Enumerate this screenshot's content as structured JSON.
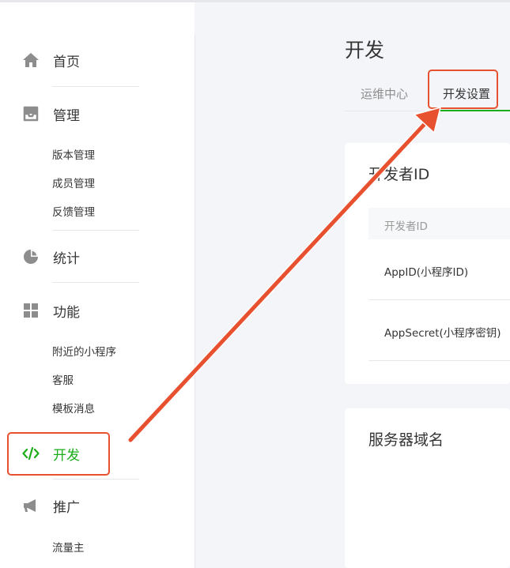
{
  "sidebar": {
    "home": "首页",
    "manage": "管理",
    "manage_items": [
      "版本管理",
      "成员管理",
      "反馈管理"
    ],
    "stats": "统计",
    "features": "功能",
    "feature_items": [
      "附近的小程序",
      "客服",
      "模板消息"
    ],
    "develop": "开发",
    "promote": "推广",
    "promote_items": [
      "流量主"
    ]
  },
  "main": {
    "title": "开发",
    "tabs": [
      {
        "label": "运维中心",
        "active": false
      },
      {
        "label": "开发设置",
        "active": true
      }
    ],
    "dev_id_card": {
      "title": "开发者ID",
      "header": "开发者ID",
      "rows": [
        "AppID(小程序ID)",
        "AppSecret(小程序密钥)"
      ]
    },
    "server_card": {
      "title": "服务器域名"
    }
  },
  "colors": {
    "accent": "#1aad19",
    "annotation": "#e8512f",
    "text": "#353535"
  },
  "icons": {
    "home": "home-icon",
    "manage": "inbox-icon",
    "stats": "pie-chart-icon",
    "features": "grid-icon",
    "develop": "code-icon",
    "promote": "megaphone-icon"
  }
}
